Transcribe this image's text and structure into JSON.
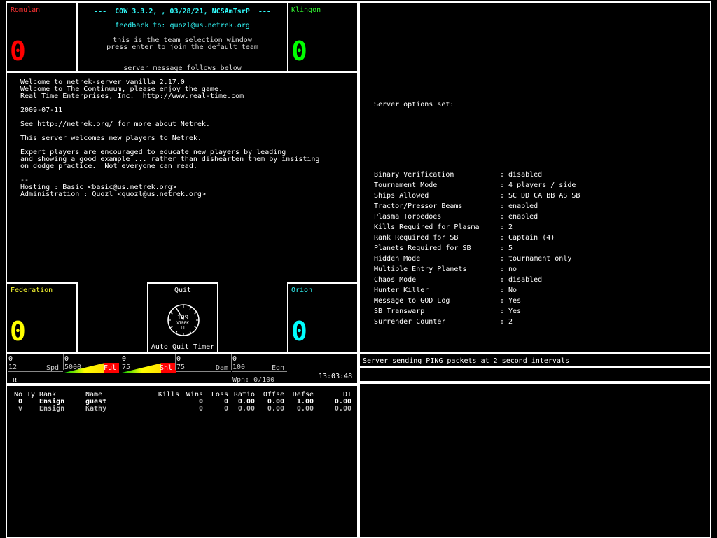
{
  "teams": {
    "romulan": {
      "name": "Romulan",
      "count": "0",
      "color": "#ff0000"
    },
    "klingon": {
      "name": "Klingon",
      "count": "0",
      "color": "#00ff00"
    },
    "federation": {
      "name": "Federation",
      "count": "0",
      "color": "#ffff00"
    },
    "orion": {
      "name": "Orion",
      "count": "0",
      "color": "#00ffff"
    }
  },
  "header": {
    "version": "---  COW 3.3.2, , 03/28/21, NCSAmTsrP  ---",
    "feedback": "feedback to: quozl@us.netrek.org",
    "info1": "this is the team selection window",
    "info2": "press enter to join the default team",
    "server_msg": "server message follows below"
  },
  "motd": [
    "Welcome to netrek-server vanilla 2.17.0",
    "Welcome to The Continuum, please enjoy the game.",
    "Real Time Enterprises, Inc.  http://www.real-time.com",
    "",
    "2009-07-11",
    "",
    "See http://netrek.org/ for more about Netrek.",
    "",
    "This server welcomes new players to Netrek.",
    "",
    "Expert players are encouraged to educate new players by leading",
    "and showing a good example ... rather than dishearten them by insisting",
    "on dodge practice.  Not everyone can read.",
    "",
    "--",
    "Hosting : Basic <basic@us.netrek.org>",
    "Administration : Quozl <quozl@us.netrek.org>"
  ],
  "quit": {
    "label": "Quit",
    "timer_label": "Auto Quit Timer",
    "seconds": "109",
    "clock_word": "XTREK",
    "clock_num": "II"
  },
  "options": {
    "heading": "Server options set:",
    "items": [
      {
        "name": "Binary Verification",
        "value": ": disabled"
      },
      {
        "name": "Tournament Mode",
        "value": ": 4 players / side"
      },
      {
        "name": "Ships Allowed",
        "value": ": SC DD CA BB AS SB"
      },
      {
        "name": "Tractor/Pressor Beams",
        "value": ": enabled"
      },
      {
        "name": "Plasma Torpedoes",
        "value": ": enabled"
      },
      {
        "name": "Kills Required for Plasma",
        "value": ": 2"
      },
      {
        "name": "Rank Required for SB",
        "value": ": Captain (4)"
      },
      {
        "name": "Planets Required for SB",
        "value": ": 5"
      },
      {
        "name": "Hidden Mode",
        "value": ": tournament only"
      },
      {
        "name": "Multiple Entry Planets",
        "value": ": no"
      },
      {
        "name": "Chaos Mode",
        "value": ": disabled"
      },
      {
        "name": "Hunter Killer",
        "value": ": No"
      },
      {
        "name": "Message to GOD Log",
        "value": ": Yes"
      },
      {
        "name": "SB Transwarp",
        "value": ": Yes"
      },
      {
        "name": "Surrender Counter",
        "value": ": 2"
      }
    ]
  },
  "stats": {
    "spd": {
      "value": "0",
      "max": "12",
      "label": "Spd"
    },
    "ful": {
      "value": "0",
      "max": "5000",
      "label": "Ful"
    },
    "shl": {
      "value": "0",
      "max": "75",
      "label": "Shl"
    },
    "dam": {
      "value": "0",
      "max": "75",
      "label": "Dam"
    },
    "egn": {
      "value": "0",
      "max": "100",
      "label": "Egn"
    },
    "wpn": "Wpn: 0/100",
    "flag": "R",
    "clock": "13:03:48"
  },
  "ping_msg": "Server sending PING packets at 2 second intervals",
  "players": {
    "headers": [
      "No",
      "Ty",
      "Rank",
      "Name",
      "Kills",
      "Wins",
      "Loss",
      "Ratio",
      "Offse",
      "Defse",
      "DI"
    ],
    "rows": [
      [
        "0",
        "",
        "Ensign",
        "guest",
        "",
        "0",
        "0",
        "0.00",
        "0.00",
        "1.00",
        "0.00"
      ],
      [
        "v",
        "",
        "Ensign",
        "Kathy",
        "",
        "0",
        "0",
        "0.00",
        "0.00",
        "0.00",
        "0.00"
      ]
    ]
  }
}
